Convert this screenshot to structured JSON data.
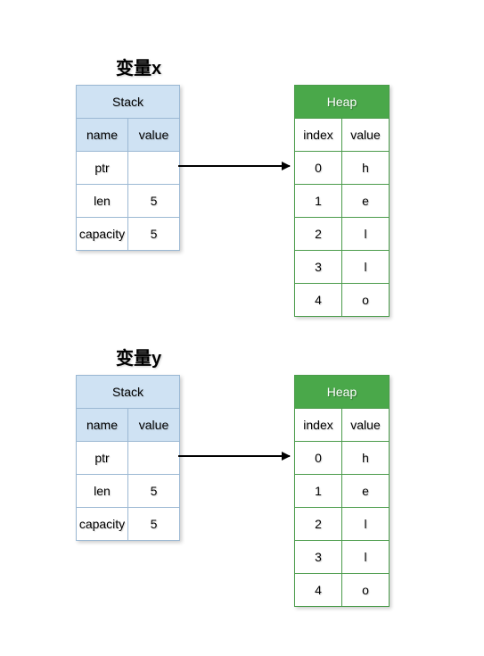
{
  "diagram": {
    "x": {
      "title": "变量x",
      "stack": {
        "header": "Stack",
        "col_name": "name",
        "col_value": "value",
        "rows": [
          {
            "name": "ptr",
            "value": ""
          },
          {
            "name": "len",
            "value": "5"
          },
          {
            "name": "capacity",
            "value": "5"
          }
        ]
      },
      "heap": {
        "header": "Heap",
        "col_index": "index",
        "col_value": "value",
        "rows": [
          {
            "index": "0",
            "value": "h"
          },
          {
            "index": "1",
            "value": "e"
          },
          {
            "index": "2",
            "value": "l"
          },
          {
            "index": "3",
            "value": "l"
          },
          {
            "index": "4",
            "value": "o"
          }
        ]
      }
    },
    "y": {
      "title": "变量y",
      "stack": {
        "header": "Stack",
        "col_name": "name",
        "col_value": "value",
        "rows": [
          {
            "name": "ptr",
            "value": ""
          },
          {
            "name": "len",
            "value": "5"
          },
          {
            "name": "capacity",
            "value": "5"
          }
        ]
      },
      "heap": {
        "header": "Heap",
        "col_index": "index",
        "col_value": "value",
        "rows": [
          {
            "index": "0",
            "value": "h"
          },
          {
            "index": "1",
            "value": "e"
          },
          {
            "index": "2",
            "value": "l"
          },
          {
            "index": "3",
            "value": "l"
          },
          {
            "index": "4",
            "value": "o"
          }
        ]
      }
    }
  }
}
